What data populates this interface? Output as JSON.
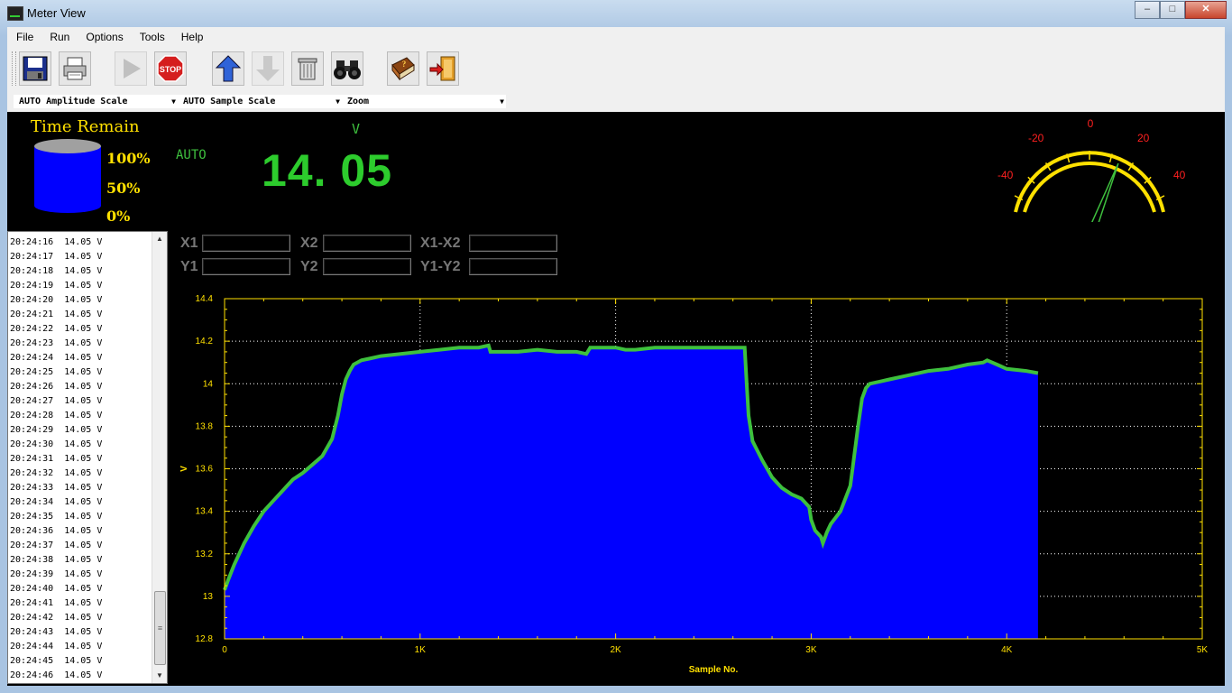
{
  "window": {
    "title": "Meter View",
    "minimize": "‒",
    "maximize": "□",
    "close": "✕"
  },
  "menu": [
    "File",
    "Run",
    "Options",
    "Tools",
    "Help"
  ],
  "toolbar": {
    "buttons": [
      {
        "name": "save-button",
        "icon": "floppy-disk-icon",
        "enabled": true
      },
      {
        "name": "print-button",
        "icon": "printer-icon",
        "enabled": true
      },
      {
        "name": "run-button",
        "icon": "play-icon",
        "enabled": false
      },
      {
        "name": "stop-button",
        "icon": "stop-sign-icon",
        "enabled": true,
        "label": "STOP"
      },
      {
        "name": "upload-button",
        "icon": "arrow-up-icon",
        "enabled": true
      },
      {
        "name": "download-button",
        "icon": "arrow-down-icon",
        "enabled": false
      },
      {
        "name": "clear-button",
        "icon": "trash-icon",
        "enabled": true
      },
      {
        "name": "find-button",
        "icon": "binoculars-icon",
        "enabled": true
      },
      {
        "name": "help-button",
        "icon": "help-book-icon",
        "enabled": true
      },
      {
        "name": "exit-button",
        "icon": "exit-door-icon",
        "enabled": true
      }
    ]
  },
  "combos": {
    "amplitude": "AUTO Amplitude Scale",
    "sample": "AUTO Sample Scale",
    "zoom": "Zoom"
  },
  "meter": {
    "time_remain_title": "Time Remain",
    "levels": [
      "100%",
      "50%",
      "0%"
    ],
    "range_mode": "AUTO",
    "unit": "V",
    "reading": "14. 05",
    "gauge_labels": [
      "-40",
      "-20",
      "0",
      "20",
      "40"
    ],
    "gauge_value": 14.05
  },
  "log": {
    "rows": [
      "20:24:16  14.05 V",
      "20:24:17  14.05 V",
      "20:24:18  14.05 V",
      "20:24:19  14.05 V",
      "20:24:20  14.05 V",
      "20:24:21  14.05 V",
      "20:24:22  14.05 V",
      "20:24:23  14.05 V",
      "20:24:24  14.05 V",
      "20:24:25  14.05 V",
      "20:24:26  14.05 V",
      "20:24:27  14.05 V",
      "20:24:28  14.05 V",
      "20:24:29  14.05 V",
      "20:24:30  14.05 V",
      "20:24:31  14.05 V",
      "20:24:32  14.05 V",
      "20:24:33  14.05 V",
      "20:24:34  14.05 V",
      "20:24:35  14.05 V",
      "20:24:36  14.05 V",
      "20:24:37  14.05 V",
      "20:24:38  14.05 V",
      "20:24:39  14.05 V",
      "20:24:40  14.05 V",
      "20:24:41  14.05 V",
      "20:24:42  14.05 V",
      "20:24:43  14.05 V",
      "20:24:44  14.05 V",
      "20:24:45  14.05 V",
      "20:24:46  14.05 V"
    ]
  },
  "cursors": {
    "x1": "X1",
    "x2": "X2",
    "x1x2": "X1-X2",
    "y1": "Y1",
    "y2": "Y2",
    "y1y2": "Y1-Y2"
  },
  "colors": {
    "trace": "#3ec03e",
    "fill": "#0000ff",
    "axis": "#ffe000",
    "gauge": "#ffe000",
    "gauge_label": "#ff2020"
  },
  "chart_data": {
    "type": "area",
    "xlabel": "Sample No.",
    "ylabel": "V",
    "xlim": [
      0,
      5000
    ],
    "ylim": [
      12.8,
      14.4
    ],
    "x_ticks": [
      "0",
      "1K",
      "2K",
      "3K",
      "4K",
      "5K"
    ],
    "y_ticks": [
      "12.8",
      "13",
      "13.2",
      "13.4",
      "13.6",
      "13.8",
      "14",
      "14.2",
      "14.4"
    ],
    "grid": true,
    "x": [
      0,
      20,
      50,
      100,
      150,
      200,
      250,
      300,
      350,
      400,
      450,
      500,
      550,
      580,
      600,
      620,
      640,
      660,
      700,
      750,
      800,
      900,
      1000,
      1100,
      1200,
      1300,
      1350,
      1360,
      1400,
      1500,
      1600,
      1700,
      1800,
      1850,
      1870,
      1900,
      2000,
      2050,
      2100,
      2200,
      2300,
      2400,
      2500,
      2600,
      2660,
      2670,
      2680,
      2700,
      2750,
      2800,
      2850,
      2900,
      2950,
      2970,
      2990,
      3000,
      3020,
      3050,
      3060,
      3080,
      3100,
      3150,
      3200,
      3240,
      3260,
      3280,
      3300,
      3350,
      3400,
      3500,
      3600,
      3700,
      3800,
      3880,
      3900,
      3950,
      4000,
      4100,
      4160
    ],
    "y": [
      13.03,
      13.08,
      13.15,
      13.25,
      13.33,
      13.4,
      13.45,
      13.5,
      13.55,
      13.58,
      13.62,
      13.66,
      13.74,
      13.85,
      13.95,
      14.02,
      14.06,
      14.09,
      14.11,
      14.12,
      14.13,
      14.14,
      14.15,
      14.16,
      14.17,
      14.17,
      14.18,
      14.15,
      14.15,
      14.15,
      14.16,
      14.15,
      14.15,
      14.14,
      14.17,
      14.17,
      14.17,
      14.16,
      14.16,
      14.17,
      14.17,
      14.17,
      14.17,
      14.17,
      14.17,
      14.0,
      13.85,
      13.73,
      13.64,
      13.56,
      13.51,
      13.48,
      13.46,
      13.44,
      13.42,
      13.36,
      13.31,
      13.28,
      13.25,
      13.3,
      13.34,
      13.4,
      13.52,
      13.8,
      13.93,
      13.98,
      14.0,
      14.01,
      14.02,
      14.04,
      14.06,
      14.07,
      14.09,
      14.1,
      14.11,
      14.09,
      14.07,
      14.06,
      14.05
    ]
  }
}
